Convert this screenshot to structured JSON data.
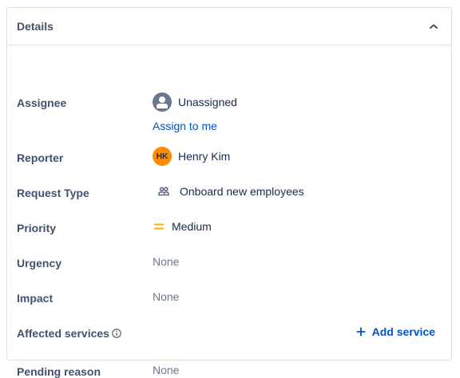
{
  "panel": {
    "title": "Details"
  },
  "fields": {
    "assignee": {
      "label": "Assignee",
      "value": "Unassigned",
      "action": "Assign to me"
    },
    "reporter": {
      "label": "Reporter",
      "initials": "HK",
      "value": "Henry Kim"
    },
    "request_type": {
      "label": "Request Type",
      "value": "Onboard new employees"
    },
    "priority": {
      "label": "Priority",
      "value": "Medium"
    },
    "urgency": {
      "label": "Urgency",
      "value": "None"
    },
    "impact": {
      "label": "Impact",
      "value": "None"
    },
    "affected_services": {
      "label": "Affected services",
      "action": "Add service"
    },
    "pending_reason": {
      "label": "Pending reason",
      "value": "None"
    }
  },
  "icons": {
    "collapse": "chevron-up-icon",
    "assignee": "default-avatar-icon",
    "request_type": "people-icon",
    "priority": "priority-medium-icon",
    "info": "info-icon",
    "add": "plus-icon"
  },
  "colors": {
    "link": "#0052cc",
    "reporter_avatar": "#ff8b00",
    "priority_medium": "#ffab00",
    "label": "#42526e",
    "muted": "#6b778c",
    "border": "#dfe1e6"
  }
}
